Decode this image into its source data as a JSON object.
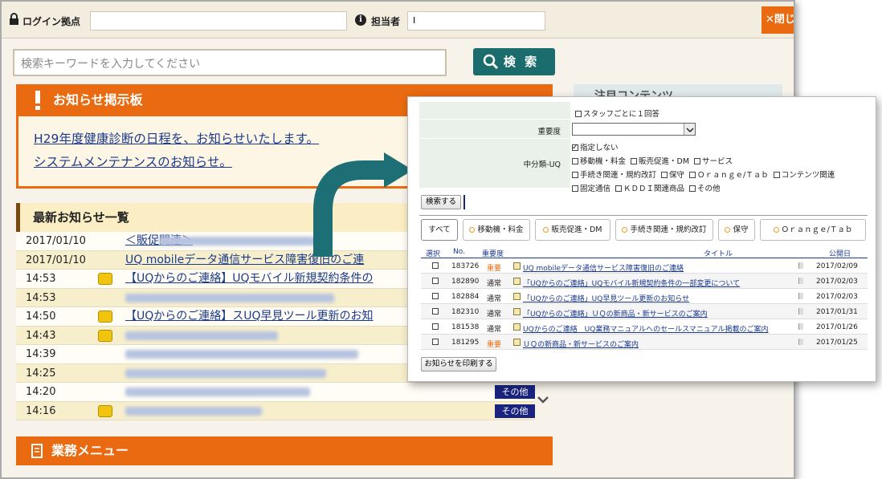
{
  "portal": {
    "login_label": "ログイン拠点",
    "person_label": "担当者",
    "person_value": "I",
    "close_label": "閉じ",
    "search_placeholder": "検索キーワードを入力してください",
    "search_button": "検 索",
    "notice_title": "お知らせ掲示板",
    "notices": [
      "H29年度健康診断の日程を、お知らせいたします。",
      "システムメンテナンスのお知らせ。"
    ],
    "news_title": "最新お知らせ一覧",
    "news_rows": [
      {
        "time": "2017/01/10",
        "title": "＜販促関連＞",
        "badge": false,
        "tag": ""
      },
      {
        "time": "2017/01/10",
        "title": "UQ mobileデータ通信サービス障害復旧のご連",
        "badge": false,
        "tag": ""
      },
      {
        "time": "14:53",
        "title": "【UQからのご連絡】UQモバイル新規契約条件の",
        "badge": true,
        "tag": ""
      },
      {
        "time": "14:53",
        "title": "",
        "badge": false,
        "tag": ""
      },
      {
        "time": "14:50",
        "title": "【UQからのご連絡】スUQ早見ツール更新のお知",
        "badge": true,
        "tag": ""
      },
      {
        "time": "14:43",
        "title": "",
        "badge": true,
        "tag": ""
      },
      {
        "time": "14:39",
        "title": "",
        "badge": false,
        "tag": ""
      },
      {
        "time": "14:25",
        "title": "",
        "badge": false,
        "tag": ""
      },
      {
        "time": "14:20",
        "title": "",
        "badge": false,
        "tag": "その他"
      },
      {
        "time": "14:16",
        "title": "",
        "badge": true,
        "tag": "その他"
      }
    ],
    "menu_title": "業務メニュー",
    "side_title": "注目コンテンツ"
  },
  "dialog": {
    "staff_option": "スタッフごとに１回答",
    "importance_label": "重要度",
    "importance_value": "",
    "category_label": "中分類-UQ",
    "categories": [
      {
        "label": "指定しない",
        "checked": true
      },
      {
        "label": "移動機・料金",
        "checked": false
      },
      {
        "label": "販売促進・DM",
        "checked": false
      },
      {
        "label": "サービス",
        "checked": false
      },
      {
        "label": "手続き関連・規約改訂",
        "checked": false
      },
      {
        "label": "保守",
        "checked": false
      },
      {
        "label": "Ｏｒａｎｇｅ/Ｔａｂ",
        "checked": false
      },
      {
        "label": "コンテンツ関連",
        "checked": false
      },
      {
        "label": "固定通信",
        "checked": false
      },
      {
        "label": "ＫＤＤＩ関連商品",
        "checked": false
      },
      {
        "label": "その他",
        "checked": false
      }
    ],
    "search_button": "検索する",
    "tabs": [
      "すべて",
      "移動機・料金",
      "販売促進・DM",
      "手続き関連・規約改訂",
      "保守",
      "Ｏｒａｎｇｅ/Ｔａｂ"
    ],
    "headers": {
      "select": "選択",
      "no": "No.",
      "importance": "重要度",
      "title": "タイトル",
      "date": "公開日"
    },
    "rows": [
      {
        "no": "183726",
        "importance": "重要",
        "title": "UQ mobileデータ通信サービス障害復旧のご連絡",
        "date": "2017/02/09"
      },
      {
        "no": "182890",
        "importance": "通常",
        "title": "「UQからのご連絡」UQモバイル新規契約条件の一部変更について",
        "date": "2017/02/03"
      },
      {
        "no": "182884",
        "importance": "通常",
        "title": "「UQからのご連絡」UQ早見ツール更新のお知らせ",
        "date": "2017/02/03"
      },
      {
        "no": "182310",
        "importance": "通常",
        "title": "「UQからのご連絡」ＵＱの新商品・新サービスのご案内",
        "date": "2017/01/31"
      },
      {
        "no": "181538",
        "importance": "通常",
        "title": "UQからのご連絡　UQ業務マニュアルへのセールスマニュアル掲載のご案内",
        "date": "2017/01/26"
      },
      {
        "no": "181295",
        "importance": "重要",
        "title": "ＵＱの新商品・新サービスのご案内",
        "date": "2017/01/25"
      }
    ],
    "print_button": "お知らせを印刷する"
  },
  "colors": {
    "accent": "#e96a10",
    "teal": "#1b6c6c",
    "link": "#1b3a8c"
  }
}
